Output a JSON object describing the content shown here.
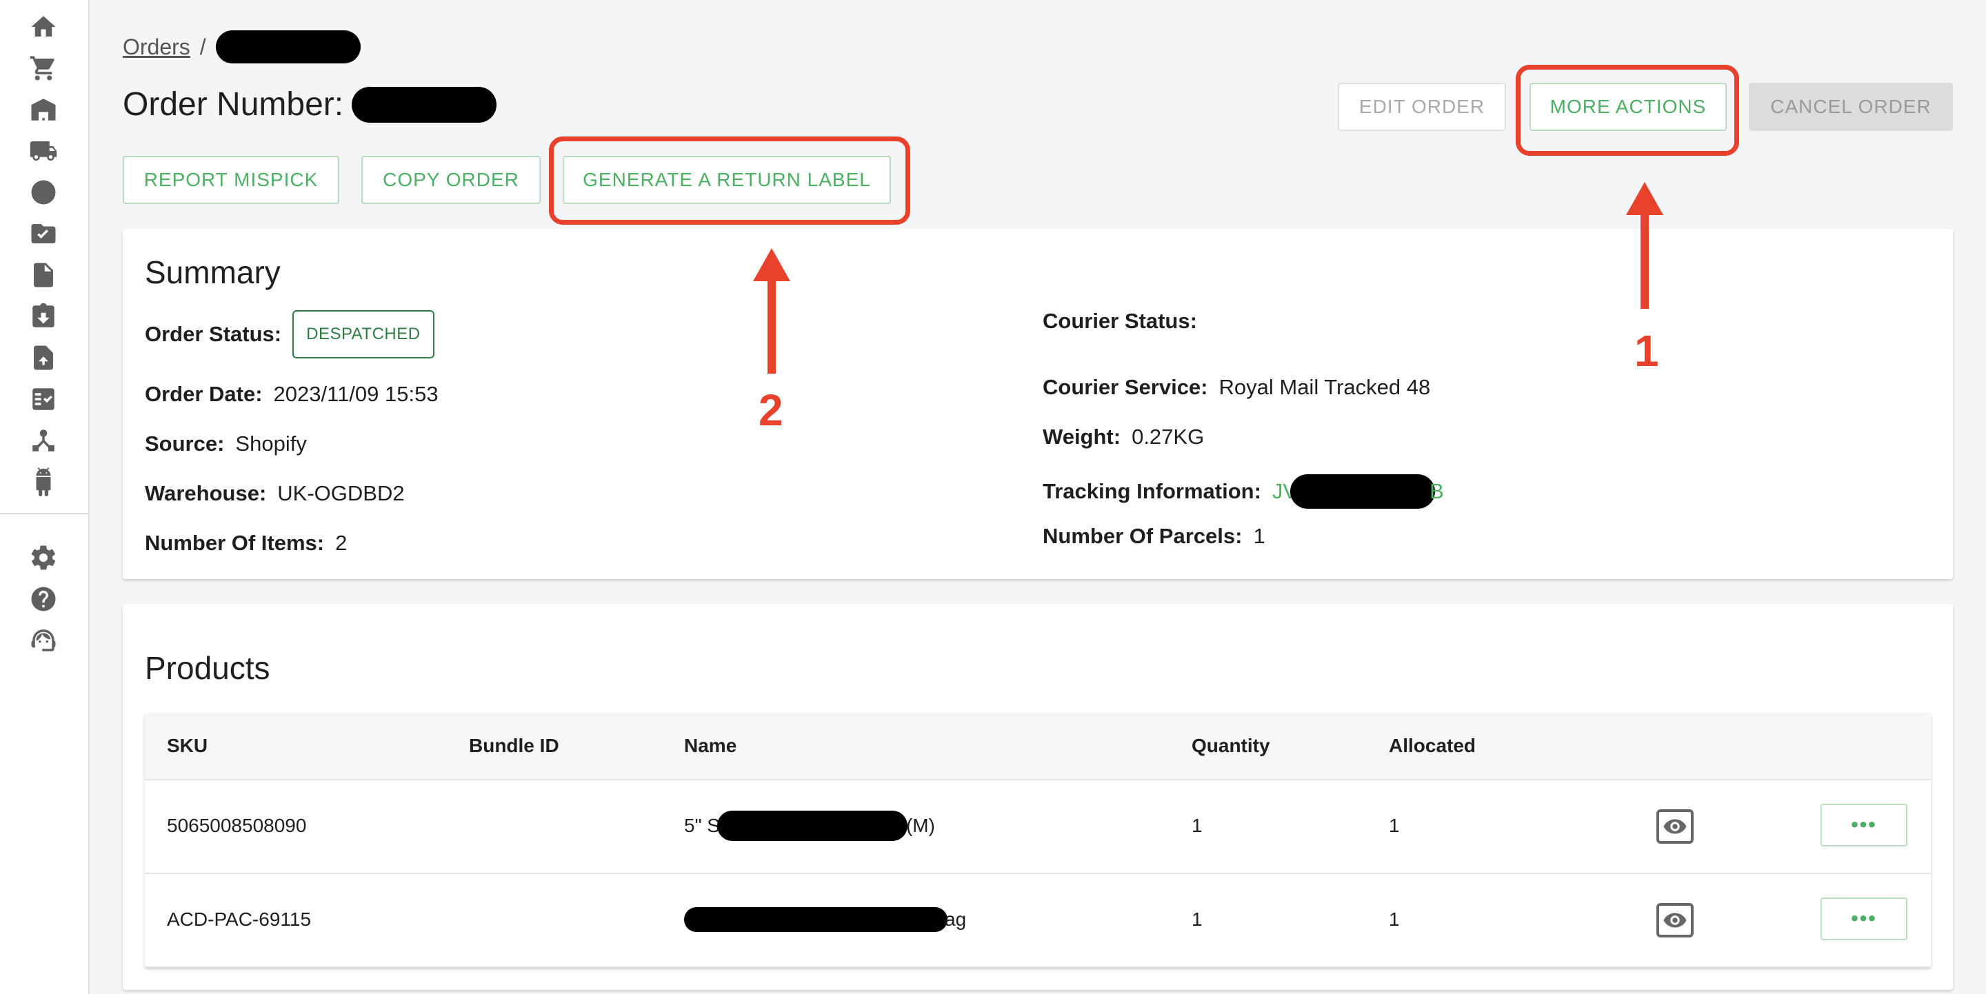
{
  "breadcrumb": {
    "root": "Orders",
    "separator": "/"
  },
  "page": {
    "title_label": "Order Number:"
  },
  "actions": {
    "edit": "EDIT ORDER",
    "more": "MORE ACTIONS",
    "cancel": "CANCEL ORDER",
    "report_mispick": "REPORT MISPICK",
    "copy": "COPY ORDER",
    "return_label": "GENERATE A RETURN LABEL"
  },
  "summary": {
    "title": "Summary",
    "status_label": "Order Status:",
    "status_value": "DESPATCHED",
    "date_label": "Order Date:",
    "date_value": "2023/11/09 15:53",
    "source_label": "Source:",
    "source_value": "Shopify",
    "warehouse_label": "Warehouse:",
    "warehouse_value": "UK-OGDBD2",
    "items_label": "Number Of Items:",
    "items_value": "2",
    "courier_status_label": "Courier Status:",
    "courier_service_label": "Courier Service:",
    "courier_service_value": "Royal Mail Tracked 48",
    "weight_label": "Weight:",
    "weight_value": "0.27KG",
    "tracking_label": "Tracking Information:",
    "tracking_prefix": "JV",
    "tracking_suffix": "B",
    "parcels_label": "Number Of Parcels:",
    "parcels_value": "1"
  },
  "products": {
    "title": "Products",
    "columns": [
      "SKU",
      "Bundle ID",
      "Name",
      "Quantity",
      "Allocated"
    ],
    "rows": [
      {
        "sku": "5065008508090",
        "bundle": "",
        "name_prefix": "5\" S",
        "name_suffix": "(M)",
        "quantity": "1",
        "allocated": "1",
        "more": "•••"
      },
      {
        "sku": "ACD-PAC-69115",
        "bundle": "",
        "name_prefix": "",
        "name_suffix": "ag",
        "quantity": "1",
        "allocated": "1",
        "more": "•••"
      }
    ]
  },
  "annotations": {
    "one": "1",
    "two": "2",
    "color": "#e8412c"
  },
  "colors": {
    "accent": "#4caf63",
    "status": "#2e7d46"
  }
}
